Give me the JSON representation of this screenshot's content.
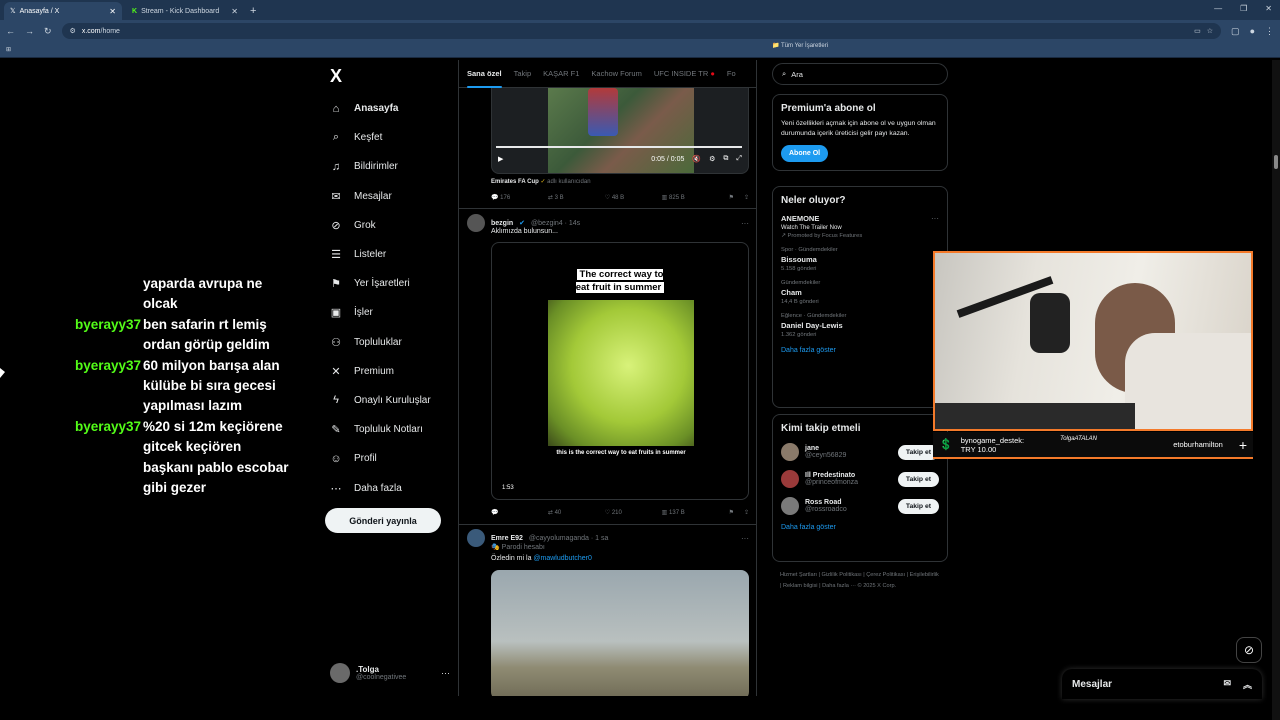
{
  "browser": {
    "tabs": [
      {
        "title": "Anasayfa / X",
        "icon": "x-logo-icon"
      },
      {
        "title": "Stream - Kick Dashboard",
        "icon": "kick-logo-icon"
      }
    ],
    "new_tab": "+",
    "url_host": "x.com",
    "url_path": "/home",
    "bookmarks_right": "Tüm Yer İşaretleri"
  },
  "chat": {
    "messages": [
      {
        "user": "",
        "text": "yaparda avrupa ne olcak"
      },
      {
        "user": "byerayy37",
        "text": "ben safarin rt lemiş ordan görüp geldim"
      },
      {
        "user": "byerayy37",
        "text": "60 milyon barışa alan külübe bi sıra gecesi yapılması lazım"
      },
      {
        "user": "byerayy37",
        "text": "%20 si 12m keçiörene gitcek keçiören başkanı pablo escobar gibi gezer"
      }
    ]
  },
  "nav": {
    "logo": "X",
    "items": [
      {
        "label": "Anasayfa",
        "icon": "home-icon",
        "glyph": "⌂"
      },
      {
        "label": "Keşfet",
        "icon": "search-icon",
        "glyph": "⌕"
      },
      {
        "label": "Bildirimler",
        "icon": "bell-icon",
        "glyph": "♫"
      },
      {
        "label": "Mesajlar",
        "icon": "mail-icon",
        "glyph": "✉"
      },
      {
        "label": "Grok",
        "icon": "grok-icon",
        "glyph": "⊘"
      },
      {
        "label": "Listeler",
        "icon": "list-icon",
        "glyph": "☰"
      },
      {
        "label": "Yer İşaretleri",
        "icon": "bookmark-icon",
        "glyph": "⚑"
      },
      {
        "label": "İşler",
        "icon": "briefcase-icon",
        "glyph": "▣"
      },
      {
        "label": "Topluluklar",
        "icon": "communities-icon",
        "glyph": "⚇"
      },
      {
        "label": "Premium",
        "icon": "x-premium-icon",
        "glyph": "✕"
      },
      {
        "label": "Onaylı Kuruluşlar",
        "icon": "lightning-icon",
        "glyph": "ϟ"
      },
      {
        "label": "Topluluk Notları",
        "icon": "notes-icon",
        "glyph": "✎"
      },
      {
        "label": "Profil",
        "icon": "profile-icon",
        "glyph": "☺"
      },
      {
        "label": "Daha fazla",
        "icon": "more-circle-icon",
        "glyph": "⋯"
      }
    ],
    "post_button": "Gönderi yayınla",
    "profile_name": ".Tolga",
    "profile_handle": "@coolnegativee"
  },
  "feed": {
    "tabs": [
      "Sana özel",
      "Takip",
      "KAŞAR F1",
      "Kachow Forum",
      "UFC INSIDE TR",
      "Fo"
    ],
    "tweet1": {
      "video_time": "0:05 / 0:05",
      "source_name": "Emirates FA Cup",
      "source_suffix": "adlı kullanıcıdan",
      "replies": "176",
      "reposts": "3 B",
      "likes": "48 B",
      "views": "825 B"
    },
    "tweet2": {
      "name": "bezgin",
      "handle": "@bezgin4 · 14s",
      "text": "Aklımızda bulunsun...",
      "caption_top": "The correct way to eat fruit in summer",
      "caption_bottom": "this is the correct way to eat fruits in summer",
      "duration": "1:53",
      "reposts": "40",
      "likes": "210",
      "views": "137 B"
    },
    "tweet3": {
      "name": "Emre E92",
      "handle": "@cayyolumaganda · 1 sa",
      "label": "Parodi hesabı",
      "text": "Özledin mi la ",
      "mention": "@mawludbutcher0"
    }
  },
  "sidebar": {
    "search_placeholder": "Ara",
    "premium": {
      "title": "Premium'a abone ol",
      "body": "Yeni özellikleri açmak için abone ol ve uygun olman durumunda içerik üreticisi gelir payı kazan.",
      "button": "Abone Ol"
    },
    "trends": {
      "title": "Neler oluyor?",
      "promo": {
        "title": "ANEMONE",
        "sub": "Watch The Trailer Now",
        "promo": "Promoted by Focus Features"
      },
      "items": [
        {
          "meta": "Spor · Gündemdekiler",
          "title": "Bissouma",
          "count": "5.158 gönderi"
        },
        {
          "meta": "Gündemdekiler",
          "title": "Cham",
          "count": "14,4 B gönderi"
        },
        {
          "meta": "Eğlence · Gündemdekiler",
          "title": "Daniel Day-Lewis",
          "count": "1.362 gönderi"
        }
      ],
      "more": "Daha fazla göster"
    },
    "who_to_follow": {
      "title": "Kimi takip etmeli",
      "people": [
        {
          "name": "jane",
          "handle": "@ceyn56829",
          "button": "Takip et"
        },
        {
          "name": "Ill Predestinato",
          "handle": "@princeofmonza",
          "button": "Takip et"
        },
        {
          "name": "Ross Road",
          "handle": "@rossroadco",
          "button": "Takip et"
        }
      ],
      "more": "Daha fazla göster"
    },
    "footer": "Hizmet Şartları | Gizlilik Politikası | Çerez Politikası | Erişilebilirlik | Reklam bilgisi | Daha fazla ··· © 2025 X Corp."
  },
  "stream_overlay": {
    "donor": "bynogame_destek:",
    "amount": "TRY 10.00",
    "signature": "TolgaATALAN",
    "user2": "etoburhamilton"
  },
  "messages_drawer": {
    "title": "Mesajlar"
  },
  "colors": {
    "accent": "#1d9bf0",
    "kick_green": "#53fc18",
    "overlay_orange": "#f47a2a"
  }
}
